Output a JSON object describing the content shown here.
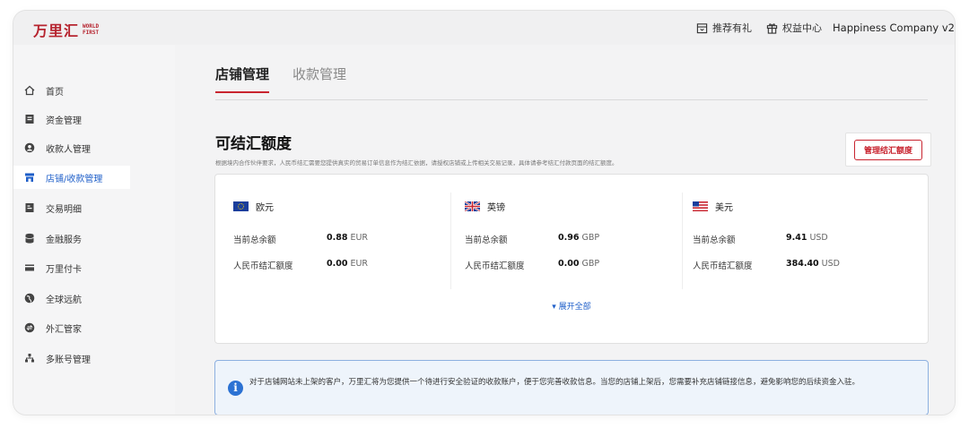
{
  "brand": {
    "logo_cn": "万里汇",
    "logo_en_line1": "WORLD",
    "logo_en_line2": "FIRST",
    "accent_color": "#c8242f",
    "link_color": "#1f5fc9"
  },
  "topbar": {
    "referral_label": "推荐有礼",
    "referral_icon": "gift-box-icon",
    "benefits_label": "权益中心",
    "benefits_icon": "gift-icon",
    "company": "Happiness Company v2"
  },
  "sidebar": {
    "items": [
      {
        "label": "首页",
        "icon": "home-icon"
      },
      {
        "label": "资金管理",
        "icon": "wallet-icon"
      },
      {
        "label": "收款人管理",
        "icon": "user-icon"
      },
      {
        "label": "店铺/收款管理",
        "icon": "store-icon",
        "active": true
      },
      {
        "label": "交易明细",
        "icon": "document-icon"
      },
      {
        "label": "金融服务",
        "icon": "database-icon"
      },
      {
        "label": "万里付卡",
        "icon": "card-icon"
      },
      {
        "label": "全球远航",
        "icon": "globe-icon"
      },
      {
        "label": "外汇管家",
        "icon": "exchange-icon"
      },
      {
        "label": "多账号管理",
        "icon": "accounts-icon"
      }
    ]
  },
  "tabs": [
    {
      "label": "店铺管理",
      "active": true
    },
    {
      "label": "收款管理",
      "active": false
    }
  ],
  "quota": {
    "title": "可结汇额度",
    "description": "根据境内合作伙伴要求，人民币结汇需要您提供真实的贸易订单信息作为结汇依据，请授权店铺或上传相关交易记录，具体请参考结汇付款页面的结汇额度。",
    "manage_button": "管理结汇额度",
    "balance_label": "当前总余额",
    "cny_quota_label": "人民币结汇额度",
    "currencies": [
      {
        "name": "欧元",
        "flag": "eu-flag-icon",
        "balance": "0.88",
        "unit": "EUR",
        "quota": "0.00",
        "quota_unit": "EUR"
      },
      {
        "name": "英镑",
        "flag": "uk-flag-icon",
        "balance": "0.96",
        "unit": "GBP",
        "quota": "0.00",
        "quota_unit": "GBP"
      },
      {
        "name": "美元",
        "flag": "us-flag-icon",
        "balance": "9.41",
        "unit": "USD",
        "quota": "384.40",
        "quota_unit": "USD"
      }
    ],
    "expand_label": "▾ 展开全部"
  },
  "notice": {
    "icon": "info-icon",
    "text": "对于店铺网站未上架的客户，万里汇将为您提供一个待进行安全验证的收款账户，便于您完善收款信息。当您的店铺上架后，您需要补充店铺链接信息，避免影响您的后续资金入驻。"
  }
}
